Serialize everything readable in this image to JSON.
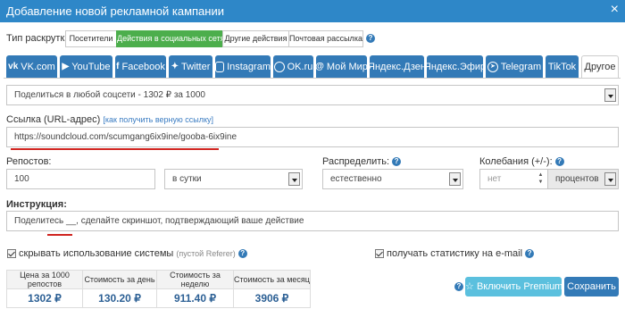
{
  "window": {
    "title": "Добавление новой рекламной кампании",
    "close": "×"
  },
  "promo_type": {
    "label": "Тип раскрутки:",
    "options": [
      "Посетители",
      "Действия в социальных сетях",
      "Другие действия",
      "Почтовая рассылка"
    ],
    "selected": "Действия в социальных сетях"
  },
  "tabs": [
    {
      "label": "VK.com",
      "icon": "vk-icon"
    },
    {
      "label": "YouTube",
      "icon": "youtube-icon"
    },
    {
      "label": "Facebook",
      "icon": "facebook-icon"
    },
    {
      "label": "Twitter",
      "icon": "twitter-icon"
    },
    {
      "label": "Instagram",
      "icon": "instagram-icon"
    },
    {
      "label": "OK.ru",
      "icon": "odnoklassniki-icon"
    },
    {
      "label": "Мой Мир",
      "icon": "mail-at-icon"
    },
    {
      "label": "Яндекс.Дзен",
      "icon": ""
    },
    {
      "label": "Яндекс.Эфир",
      "icon": ""
    },
    {
      "label": "Telegram",
      "icon": "telegram-icon"
    },
    {
      "label": "TikTok",
      "icon": ""
    },
    {
      "label": "Другое",
      "icon": ""
    }
  ],
  "active_tab": "Другое",
  "action_select": {
    "value": "Поделиться в любой соцсети - 1302 ₽ за 1000"
  },
  "url": {
    "label": "Ссылка (URL-адрес)",
    "help_link": "[как получить верную ссылку]",
    "value": "https://soundcloud.com/scumgang6ix9ine/gooba-6ix9ine"
  },
  "reposts": {
    "label": "Репостов:",
    "value": "100"
  },
  "period": {
    "value": "в сутки"
  },
  "distribute": {
    "label": "Распределить:",
    "value": "естественно"
  },
  "fluctuation": {
    "label": "Колебания (+/-):",
    "placeholder": "нет",
    "unit": "процентов"
  },
  "instruction": {
    "label": "Инструкция:",
    "value": "Поделитесь __, сделайте скриншот, подтверждающий ваше действие"
  },
  "hide_system": {
    "label": "скрывать использование системы",
    "note": "(пустой Referer)",
    "checked": true
  },
  "email_stats": {
    "label": "получать статистику на e-mail",
    "checked": true
  },
  "stats_table": {
    "headers": [
      "Цена за 1000 репостов",
      "Стоимость за день",
      "Стоимость за неделю",
      "Стоимость за месяц"
    ],
    "values": [
      "1302 ₽",
      "130.20 ₽",
      "911.40 ₽",
      "3906 ₽"
    ]
  },
  "buttons": {
    "premium": "Включить Premium",
    "save": "Сохранить"
  },
  "colors": {
    "primary": "#337ab7",
    "success": "#4cae4c",
    "info": "#5bc0de",
    "accent_line": "#d0231f"
  }
}
